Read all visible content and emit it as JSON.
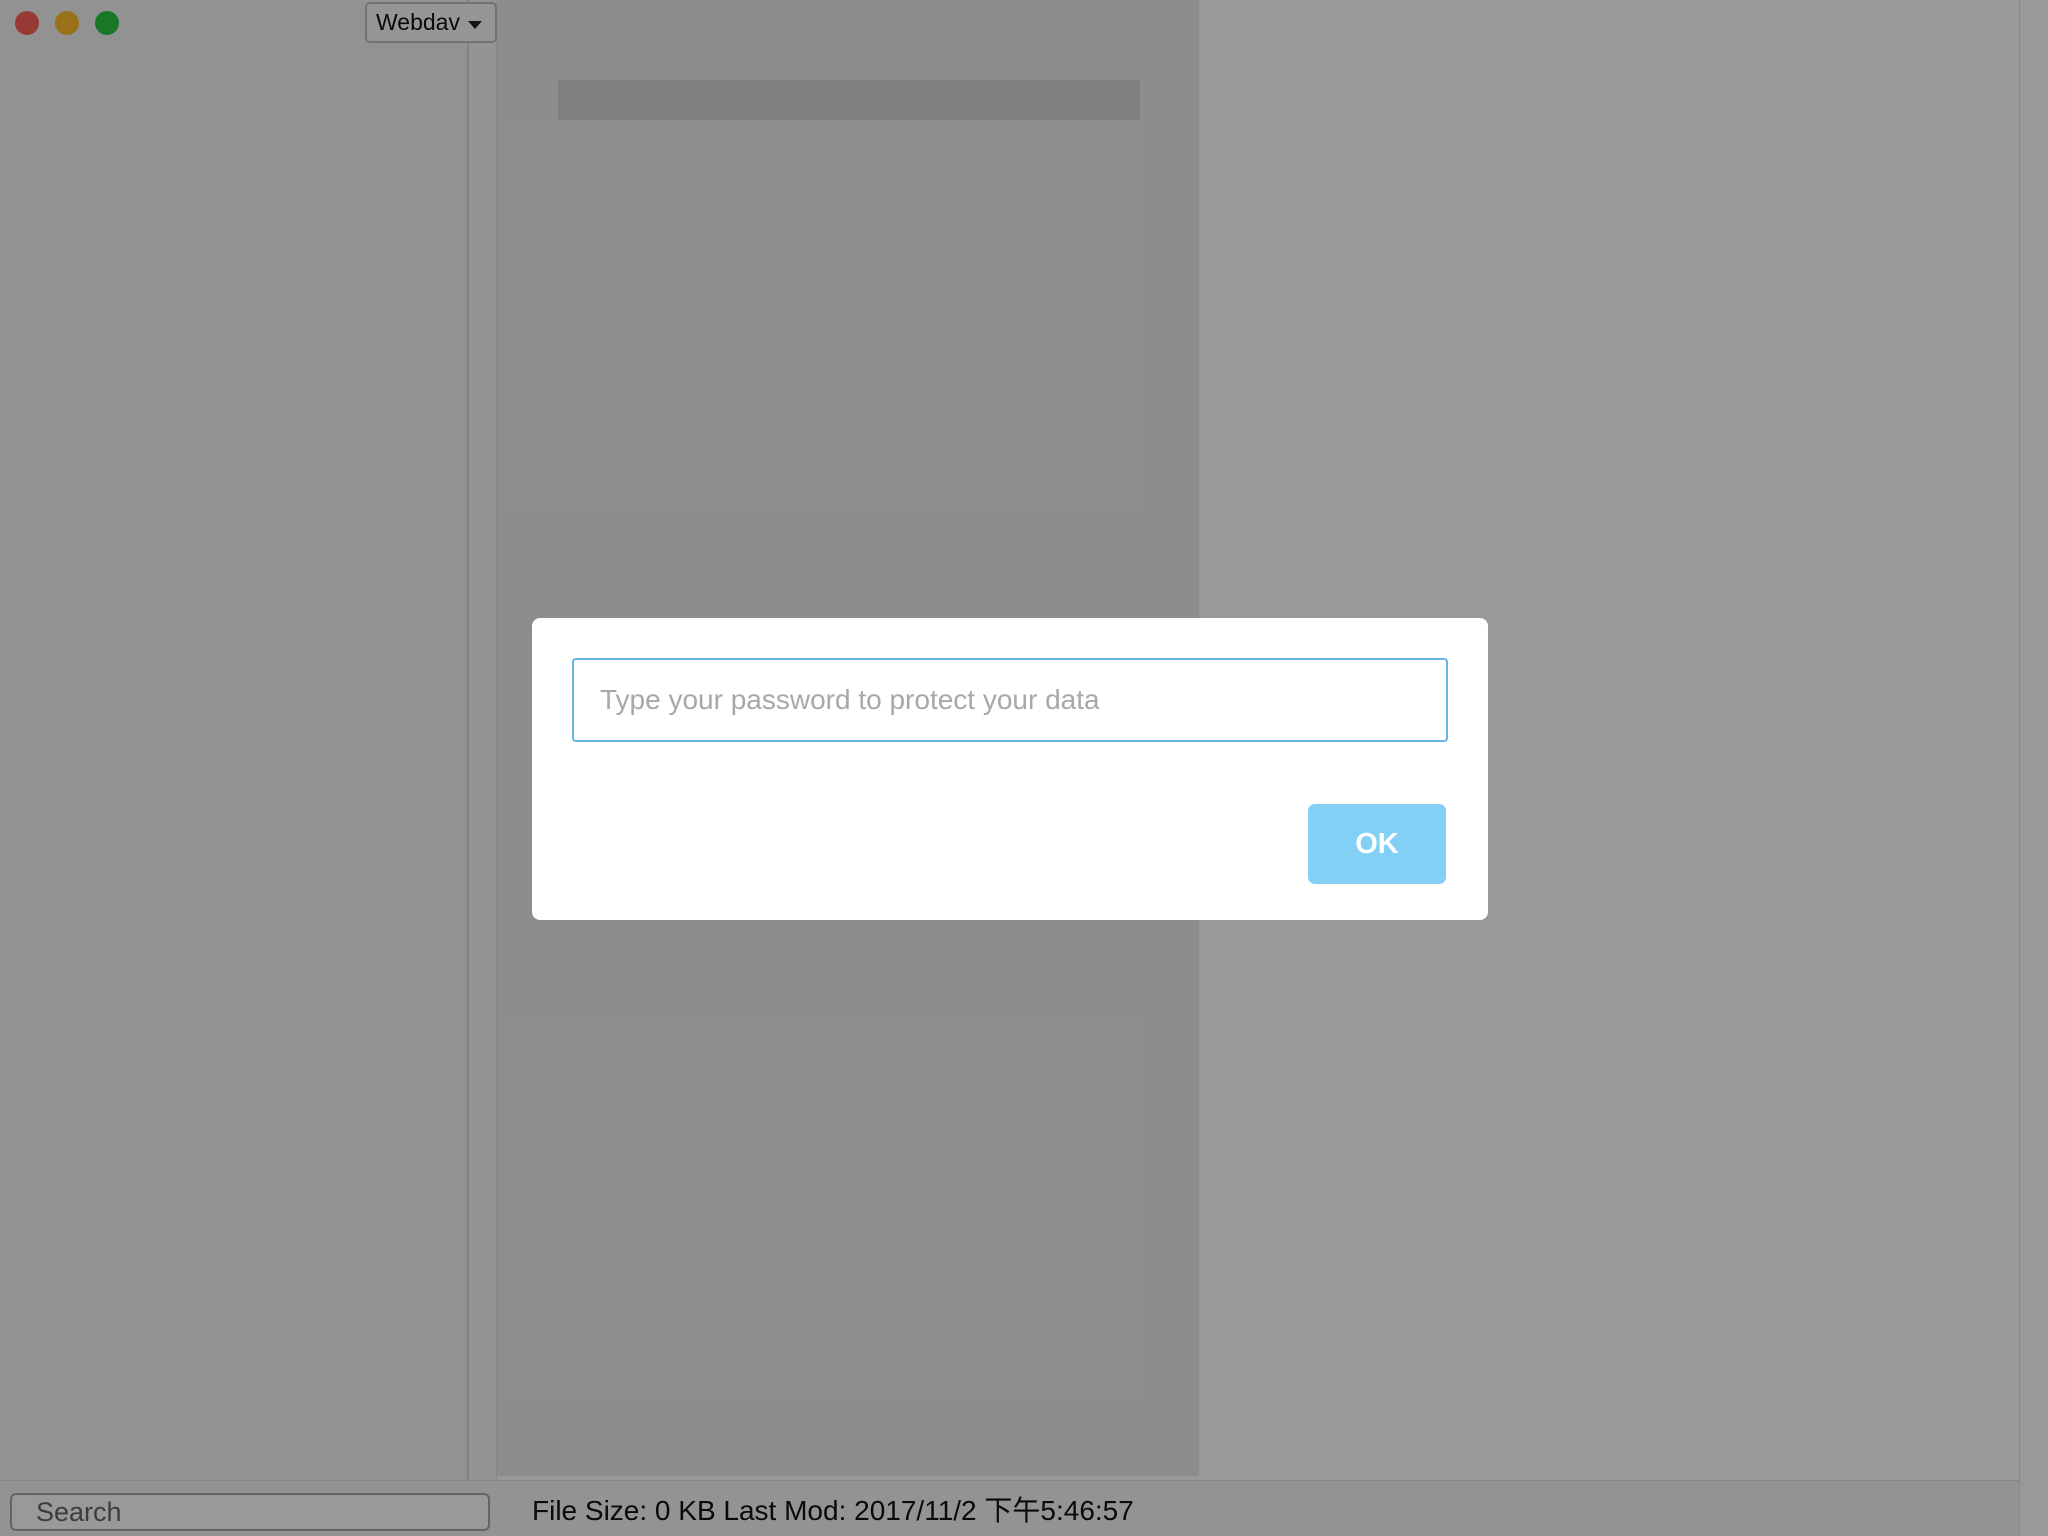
{
  "colors": {
    "close": "#ff5f57",
    "minimize": "#ffbd2e",
    "maximize": "#28c840",
    "accent": "#82d0f6",
    "input_border": "#66b3e6"
  },
  "titlebar": {
    "source_selector": {
      "value": "Webdav",
      "icon": "chevron-down-icon"
    }
  },
  "bottombar": {
    "search_placeholder": "Search",
    "status": "File Size: 0 KB Last Mod: 2017/11/2 下午5:46:57"
  },
  "dialog": {
    "password_placeholder": "Type your password to protect your data",
    "password_value": "",
    "ok_label": "OK"
  }
}
